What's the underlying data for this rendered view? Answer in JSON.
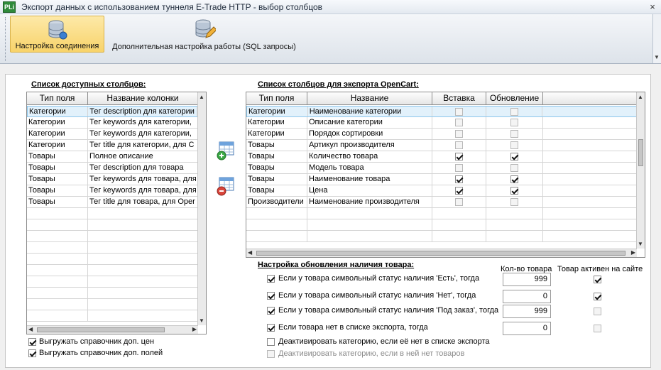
{
  "window": {
    "icon_text": "PLi",
    "title": "Экспорт данных с использованием туннеля E-Trade HTTP - выбор столбцов",
    "close_glyph": "×"
  },
  "toolbar": {
    "buttons": [
      {
        "label": "Настройка соединения",
        "icon": "database-settings-icon",
        "active": true
      },
      {
        "label": "Дополнительная настройка работы (SQL запросы)",
        "icon": "database-edit-icon",
        "active": false
      }
    ]
  },
  "available": {
    "title": "Список доступных столбцов:",
    "columns": [
      "Тип поля",
      "Название колонки"
    ],
    "rows": [
      [
        "Категории",
        "Тег description для категории"
      ],
      [
        "Категории",
        "Тег keywords для категории,"
      ],
      [
        "Категории",
        "Тег keywords для категории,"
      ],
      [
        "Категории",
        "Тег title для категории, для С"
      ],
      [
        "Товары",
        "Полное описание"
      ],
      [
        "Товары",
        "Тег description для товара"
      ],
      [
        "Товары",
        "Тег keywords для товара, для"
      ],
      [
        "Товары",
        "Тег keywords для товара, для"
      ],
      [
        "Товары",
        "Тег title для товара, для Oper"
      ]
    ]
  },
  "export": {
    "title": "Список столбцов для экспорта OpenCart:",
    "columns": [
      "Тип поля",
      "Название",
      "Вставка",
      "Обновление"
    ],
    "rows": [
      {
        "type": "Категории",
        "name": "Наименование категории",
        "insert": false,
        "update": false
      },
      {
        "type": "Категории",
        "name": "Описание категории",
        "insert": false,
        "update": false
      },
      {
        "type": "Категории",
        "name": "Порядок сортировки",
        "insert": false,
        "update": false
      },
      {
        "type": "Товары",
        "name": "Артикул производителя",
        "insert": false,
        "update": false
      },
      {
        "type": "Товары",
        "name": "Количество товара",
        "insert": true,
        "update": true
      },
      {
        "type": "Товары",
        "name": "Модель товара",
        "insert": false,
        "update": false
      },
      {
        "type": "Товары",
        "name": "Наименование товара",
        "insert": true,
        "update": true
      },
      {
        "type": "Товары",
        "name": "Цена",
        "insert": true,
        "update": true
      },
      {
        "type": "Производители",
        "name": "Наименование производителя",
        "insert": false,
        "update": false
      }
    ]
  },
  "stock": {
    "title": "Настройка обновления наличия товара:",
    "qty_header": "Кол-во товара",
    "active_header": "Товар активен на сайте",
    "rules": [
      {
        "label": "Если у товара символьный статус наличия 'Есть', тогда",
        "checked": true,
        "qty": "999",
        "active": true
      },
      {
        "label": "Если у товара символьный статус наличия 'Нет', тогда",
        "checked": true,
        "qty": "0",
        "active": true
      },
      {
        "label": "Если у товара символьный статус наличия 'Под заказ', тогда",
        "checked": true,
        "qty": "999",
        "active": false
      },
      {
        "label": "Если товара нет в списке экспорта, тогда",
        "checked": true,
        "qty": "0",
        "active": false
      }
    ],
    "deactivate_missing": "Деактивировать категорию, если её нет в списке экспорта",
    "deactivate_empty": "Деактивировать категорию, если в ней нет товаров"
  },
  "options": {
    "export_price_ref": "Выгружать справочник доп. цен",
    "export_fields_ref": "Выгружать справочник доп. полей"
  }
}
